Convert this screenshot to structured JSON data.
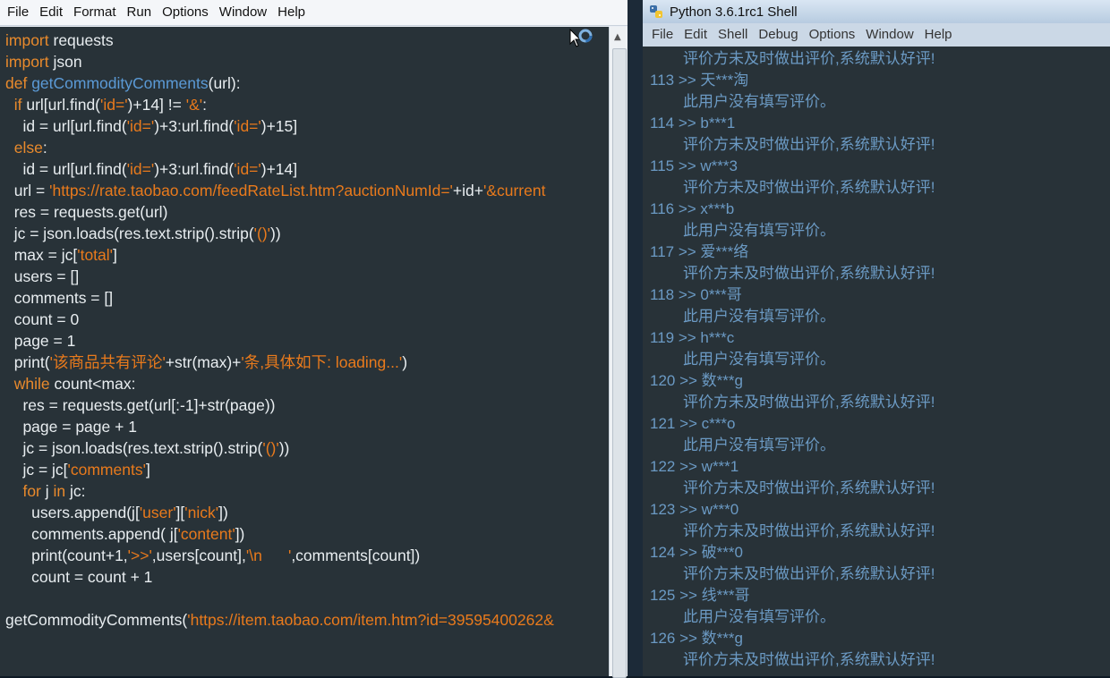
{
  "editor": {
    "menu": [
      "File",
      "Edit",
      "Format",
      "Run",
      "Options",
      "Window",
      "Help"
    ],
    "code_lines": [
      [
        [
          "kw",
          "import"
        ],
        [
          "t",
          " requests"
        ]
      ],
      [
        [
          "kw",
          "import"
        ],
        [
          "t",
          " json"
        ]
      ],
      [
        [
          "kw",
          "def"
        ],
        [
          "t",
          " "
        ],
        [
          "fn",
          "getCommodityComments"
        ],
        [
          "t",
          "(url):"
        ]
      ],
      [
        [
          "t",
          "  "
        ],
        [
          "kw",
          "if"
        ],
        [
          "t",
          " url[url.find("
        ],
        [
          "st",
          "'id='"
        ],
        [
          "t",
          ")+14] != "
        ],
        [
          "st",
          "'&'"
        ],
        [
          "t",
          ":"
        ]
      ],
      [
        [
          "t",
          "    id = url[url.find("
        ],
        [
          "st",
          "'id='"
        ],
        [
          "t",
          ")+3:url.find("
        ],
        [
          "st",
          "'id='"
        ],
        [
          "t",
          ")+15]"
        ]
      ],
      [
        [
          "t",
          "  "
        ],
        [
          "kw",
          "else"
        ],
        [
          "t",
          ":"
        ]
      ],
      [
        [
          "t",
          "    id = url[url.find("
        ],
        [
          "st",
          "'id='"
        ],
        [
          "t",
          ")+3:url.find("
        ],
        [
          "st",
          "'id='"
        ],
        [
          "t",
          ")+14]"
        ]
      ],
      [
        [
          "t",
          "  url = "
        ],
        [
          "st",
          "'https://rate.taobao.com/feedRateList.htm?auctionNumId='"
        ],
        [
          "t",
          "+id+"
        ],
        [
          "st",
          "'&current"
        ]
      ],
      [
        [
          "t",
          "  res = requests.get(url)"
        ]
      ],
      [
        [
          "t",
          "  jc = json.loads(res.text.strip().strip("
        ],
        [
          "st",
          "'()'"
        ],
        [
          "t",
          "))"
        ]
      ],
      [
        [
          "t",
          "  max = jc["
        ],
        [
          "st",
          "'total'"
        ],
        [
          "t",
          "]"
        ]
      ],
      [
        [
          "t",
          "  users = []"
        ]
      ],
      [
        [
          "t",
          "  comments = []"
        ]
      ],
      [
        [
          "t",
          "  count = 0"
        ]
      ],
      [
        [
          "t",
          "  page = 1"
        ]
      ],
      [
        [
          "t",
          "  print("
        ],
        [
          "st",
          "'该商品共有评论'"
        ],
        [
          "t",
          "+str(max)+"
        ],
        [
          "st",
          "'条,具体如下: loading...'"
        ],
        [
          "t",
          ")"
        ]
      ],
      [
        [
          "t",
          "  "
        ],
        [
          "kw",
          "while"
        ],
        [
          "t",
          " count<max:"
        ]
      ],
      [
        [
          "t",
          "    res = requests.get(url[:-1]+str(page))"
        ]
      ],
      [
        [
          "t",
          "    page = page + 1"
        ]
      ],
      [
        [
          "t",
          "    jc = json.loads(res.text.strip().strip("
        ],
        [
          "st",
          "'()'"
        ],
        [
          "t",
          "))"
        ]
      ],
      [
        [
          "t",
          "    jc = jc["
        ],
        [
          "st",
          "'comments'"
        ],
        [
          "t",
          "]"
        ]
      ],
      [
        [
          "t",
          "    "
        ],
        [
          "kw",
          "for"
        ],
        [
          "t",
          " j "
        ],
        [
          "kw",
          "in"
        ],
        [
          "t",
          " jc:"
        ]
      ],
      [
        [
          "t",
          "      users.append(j["
        ],
        [
          "st",
          "'user'"
        ],
        [
          "t",
          "]["
        ],
        [
          "st",
          "'nick'"
        ],
        [
          "t",
          "])"
        ]
      ],
      [
        [
          "t",
          "      comments.append( j["
        ],
        [
          "st",
          "'content'"
        ],
        [
          "t",
          "])"
        ]
      ],
      [
        [
          "t",
          "      print(count+1,"
        ],
        [
          "st",
          "'>>'"
        ],
        [
          "t",
          ",users[count],"
        ],
        [
          "st",
          "'\\n      '"
        ],
        [
          "t",
          ",comments[count])"
        ]
      ],
      [
        [
          "t",
          "      count = count + 1"
        ]
      ],
      [
        [
          "t",
          ""
        ]
      ],
      [
        [
          "t",
          "getCommodityComments("
        ],
        [
          "st",
          "'https://item.taobao.com/item.htm?id=39595400262&"
        ]
      ]
    ]
  },
  "shell": {
    "title": "Python 3.6.1rc1 Shell",
    "menu": [
      "File",
      "Edit",
      "Shell",
      "Debug",
      "Options",
      "Window",
      "Help"
    ],
    "output_lines": [
      {
        "indent": true,
        "text": "评价方未及时做出评价,系统默认好评!"
      },
      {
        "indent": false,
        "text": "113 >> 天***淘"
      },
      {
        "indent": true,
        "text": "此用户没有填写评价。"
      },
      {
        "indent": false,
        "text": "114 >> b***1"
      },
      {
        "indent": true,
        "text": "评价方未及时做出评价,系统默认好评!"
      },
      {
        "indent": false,
        "text": "115 >> w***3"
      },
      {
        "indent": true,
        "text": "评价方未及时做出评价,系统默认好评!"
      },
      {
        "indent": false,
        "text": "116 >> x***b"
      },
      {
        "indent": true,
        "text": "此用户没有填写评价。"
      },
      {
        "indent": false,
        "text": "117 >> 爱***络"
      },
      {
        "indent": true,
        "text": "评价方未及时做出评价,系统默认好评!"
      },
      {
        "indent": false,
        "text": "118 >> 0***哥"
      },
      {
        "indent": true,
        "text": "此用户没有填写评价。"
      },
      {
        "indent": false,
        "text": "119 >> h***c"
      },
      {
        "indent": true,
        "text": "此用户没有填写评价。"
      },
      {
        "indent": false,
        "text": "120 >> 数***g"
      },
      {
        "indent": true,
        "text": "评价方未及时做出评价,系统默认好评!"
      },
      {
        "indent": false,
        "text": "121 >> c***o"
      },
      {
        "indent": true,
        "text": "此用户没有填写评价。"
      },
      {
        "indent": false,
        "text": "122 >> w***1"
      },
      {
        "indent": true,
        "text": "评价方未及时做出评价,系统默认好评!"
      },
      {
        "indent": false,
        "text": "123 >> w***0"
      },
      {
        "indent": true,
        "text": "评价方未及时做出评价,系统默认好评!"
      },
      {
        "indent": false,
        "text": "124 >> 破***0"
      },
      {
        "indent": true,
        "text": "评价方未及时做出评价,系统默认好评!"
      },
      {
        "indent": false,
        "text": "125 >> 线***哥"
      },
      {
        "indent": true,
        "text": "此用户没有填写评价。"
      },
      {
        "indent": false,
        "text": "126 >> 数***g"
      },
      {
        "indent": true,
        "text": "评价方未及时做出评价,系统默认好评!"
      }
    ]
  },
  "icons": {
    "shell_title_icon": "python-icon",
    "cursor": "busy-cursor-icon",
    "scroll_up": "scroll-up-arrow-icon"
  }
}
